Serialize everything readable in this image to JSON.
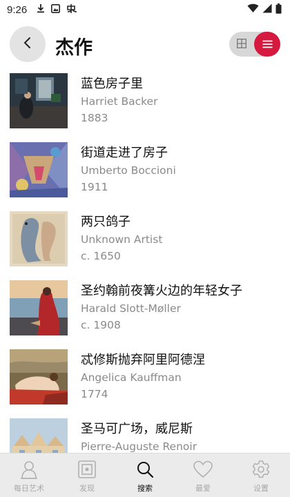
{
  "status_bar": {
    "time": "9:26"
  },
  "header": {
    "title": "杰作"
  },
  "artworks": [
    {
      "title": "蓝色房子里",
      "artist": "Harriet Backer",
      "year": "1883"
    },
    {
      "title": "街道走进了房子",
      "artist": "Umberto Boccioni",
      "year": "1911"
    },
    {
      "title": "两只鸽子",
      "artist": "Unknown Artist",
      "year": "c. 1650"
    },
    {
      "title": "圣约翰前夜篝火边的年轻女子",
      "artist": "Harald Slott-Møller",
      "year": "c. 1908"
    },
    {
      "title": "忒修斯抛弃阿里阿德涅",
      "artist": "Angelica Kauffman",
      "year": "1774"
    },
    {
      "title": "圣马可广场，威尼斯",
      "artist": "Pierre-Auguste Renoir",
      "year": ""
    }
  ],
  "bottom_nav": [
    {
      "label": "每日艺术",
      "icon": "daily-art-icon",
      "active": false
    },
    {
      "label": "发现",
      "icon": "discover-frame-icon",
      "active": false
    },
    {
      "label": "搜索",
      "icon": "search-icon",
      "active": true
    },
    {
      "label": "最爱",
      "icon": "heart-icon",
      "active": false
    },
    {
      "label": "设置",
      "icon": "gear-icon",
      "active": false
    }
  ],
  "colors": {
    "accent": "#d6193e",
    "nav_background": "#ebebeb",
    "secondary_text": "#8a8a8a"
  }
}
